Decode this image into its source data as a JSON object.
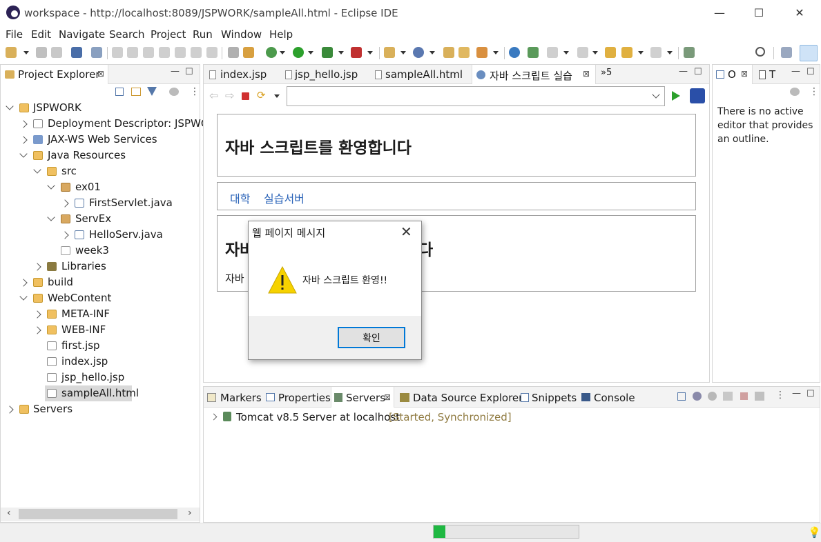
{
  "window": {
    "title": "workspace - http://localhost:8089/JSPWORK/sampleAll.html - Eclipse IDE"
  },
  "menu": [
    "File",
    "Edit",
    "Navigate",
    "Search",
    "Project",
    "Run",
    "Window",
    "Help"
  ],
  "project_explorer": {
    "tab_label": "Project Explorer",
    "tree": [
      {
        "label": "JSPWORK"
      },
      {
        "label": "Deployment Descriptor: JSPWOR"
      },
      {
        "label": "JAX-WS Web Services"
      },
      {
        "label": "Java Resources"
      },
      {
        "label": "src"
      },
      {
        "label": "ex01"
      },
      {
        "label": "FirstServlet.java"
      },
      {
        "label": "ServEx"
      },
      {
        "label": "HelloServ.java"
      },
      {
        "label": "week3"
      },
      {
        "label": "Libraries"
      },
      {
        "label": "build"
      },
      {
        "label": "WebContent"
      },
      {
        "label": "META-INF"
      },
      {
        "label": "WEB-INF"
      },
      {
        "label": "first.jsp"
      },
      {
        "label": "index.jsp"
      },
      {
        "label": "jsp_hello.jsp"
      },
      {
        "label": "sampleAll.html"
      },
      {
        "label": "Servers"
      }
    ]
  },
  "editor": {
    "tabs": [
      "index.jsp",
      "jsp_hello.jsp",
      "sampleAll.html",
      "자바 스크립트 실습"
    ],
    "overflow": "»5",
    "url_value": ""
  },
  "page": {
    "heading1": "자바 스크립트를 환영합니다",
    "nav_links": [
      "대학",
      "실습서버"
    ],
    "heading2_prefix": "자바",
    "heading2_suffix": "다",
    "para_prefix": "자바"
  },
  "outline": {
    "tab1": "O",
    "tab2": "T",
    "message": "There is no active editor that provides an outline."
  },
  "bottom": {
    "tabs": [
      "Markers",
      "Properties",
      "Servers",
      "Data Source Explorer",
      "Snippets",
      "Console"
    ],
    "server_name": "Tomcat v8.5 Server at localhost",
    "server_status": "[Started, Synchronized]"
  },
  "dialog": {
    "title": "웹 페이지 메시지",
    "message": "자바 스크립트 환영!!",
    "ok_label": "확인"
  },
  "statusbar": {
    "progress": 0.08
  }
}
